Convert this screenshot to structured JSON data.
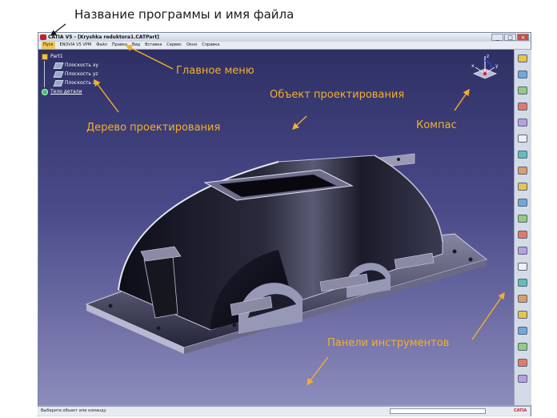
{
  "caption": {
    "top": "Название программы и имя файла"
  },
  "window": {
    "title": "CATIA V5 - [Kryshka reduktora1.CATPart]",
    "controls": {
      "minimize": "_",
      "maximize": "□",
      "close": "×"
    }
  },
  "menu": {
    "items": [
      "Пуск",
      "ENOVIA V5 VPM",
      "Файл",
      "Правка",
      "Вид",
      "Вставка",
      "Сервис",
      "Окно",
      "Справка"
    ]
  },
  "tree": {
    "root": "Part1",
    "planes": [
      "Плоскость xy",
      "Плоскость yz",
      "Плоскость zx"
    ],
    "body": "Тело детали"
  },
  "compass": {
    "axis_x": "x",
    "axis_y": "y",
    "axis_z": "z"
  },
  "annotations": {
    "menu": "Главное меню",
    "object": "Объект проектирования",
    "tree": "Дерево проектирования",
    "compass": "Компас",
    "toolbars": "Панели инструментов"
  },
  "status": {
    "prompt": "Выберите объект или команду",
    "brand": "CATIA"
  },
  "colors": {
    "annotation": "#f4b02a",
    "viewport_top": "#2e3064",
    "viewport_bottom": "#8c8cbc",
    "model": "#1c1c2a"
  },
  "icons": {
    "right_toolbar": [
      "compass-tool-icon",
      "sketch-icon",
      "pad-icon",
      "pocket-icon",
      "shaft-icon",
      "groove-icon",
      "hole-icon",
      "rib-icon",
      "slot-icon",
      "stiffener-icon",
      "loft-icon",
      "fillet-icon",
      "chamfer-icon",
      "draft-icon",
      "shell-icon",
      "thickness-icon",
      "thread-icon",
      "mirror-icon",
      "pattern-icon",
      "scale-icon",
      "measure-icon"
    ],
    "bottom_toolbar": [
      "new-icon",
      "open-icon",
      "save-icon",
      "print-icon",
      "cut-icon",
      "copy-icon",
      "paste-icon",
      "undo-icon",
      "redo-icon",
      "help-icon",
      "fly-icon",
      "zoom-in-icon",
      "zoom-out-icon",
      "pan-icon",
      "rotate-icon",
      "fit-all-icon",
      "normal-view-icon",
      "shading-icon",
      "hide-show-icon",
      "swap-icon",
      "render-icon",
      "material-icon",
      "update-icon",
      "axis-icon",
      "measure-icon",
      "analysis-icon",
      "catalog-icon"
    ]
  }
}
